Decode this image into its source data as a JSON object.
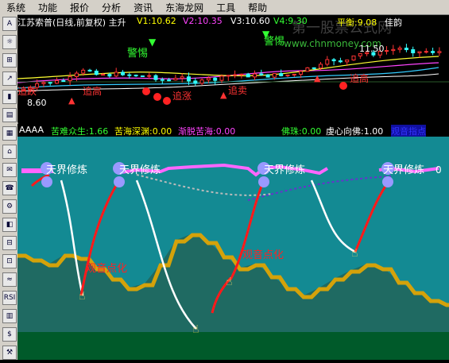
{
  "menu": {
    "items": [
      "系统",
      "功能",
      "报价",
      "分析",
      "资讯",
      "东海龙网",
      "工具",
      "帮助"
    ]
  },
  "toolbar": {
    "buttons": [
      "A",
      "☼",
      "⊞",
      "↗",
      "▮",
      "▤",
      "▦",
      "⌂",
      "✉",
      "☎",
      "⚙",
      "◧",
      "⊟",
      "⊡",
      "≈",
      "RSI",
      "▥",
      "$",
      "⚒"
    ]
  },
  "kline_panel": {
    "title": "江苏索普(日线,前复权) 主升",
    "v1": "V1:10.62",
    "v2": "V2:10.35",
    "v3": "V3:10.60",
    "v4": "V4:9.30",
    "pingheng": "平衡:9.08",
    "jiyun": "佳韵",
    "high_value": "11.50",
    "low_value": "8.60",
    "label_jingti": "警惕",
    "label_zhuidi": "追跌",
    "label_zhuigao": "追高",
    "label_zhuizhang": "追涨",
    "label_zhuimai": "追卖"
  },
  "indicator_header": {
    "name": "AAAA",
    "kunan": "苦难众生:1.66",
    "kuhai": "苦海深渊:0.00",
    "jiantuo": "渐脱苦海:0.00",
    "fozhu": "佛珠:0.00",
    "xuxin": "虔心向佛:1.00",
    "guanyin_zhizhi": "观音指点"
  },
  "indicator_panel": {
    "tianjie": "天界修炼",
    "guanyin": "观音点化",
    "right_value": "0"
  },
  "watermark": {
    "line1": "第一股票公式网",
    "line2": "www.chnmoney.com"
  },
  "colors": {
    "panel_bg": "#138a93",
    "ground": "#005a2a",
    "mountain": "#1f6a62",
    "ridge": "#d4a20a",
    "red_line": "#ff1a1a",
    "white_line": "#ffffff",
    "magenta_band": "#ff66ff"
  }
}
